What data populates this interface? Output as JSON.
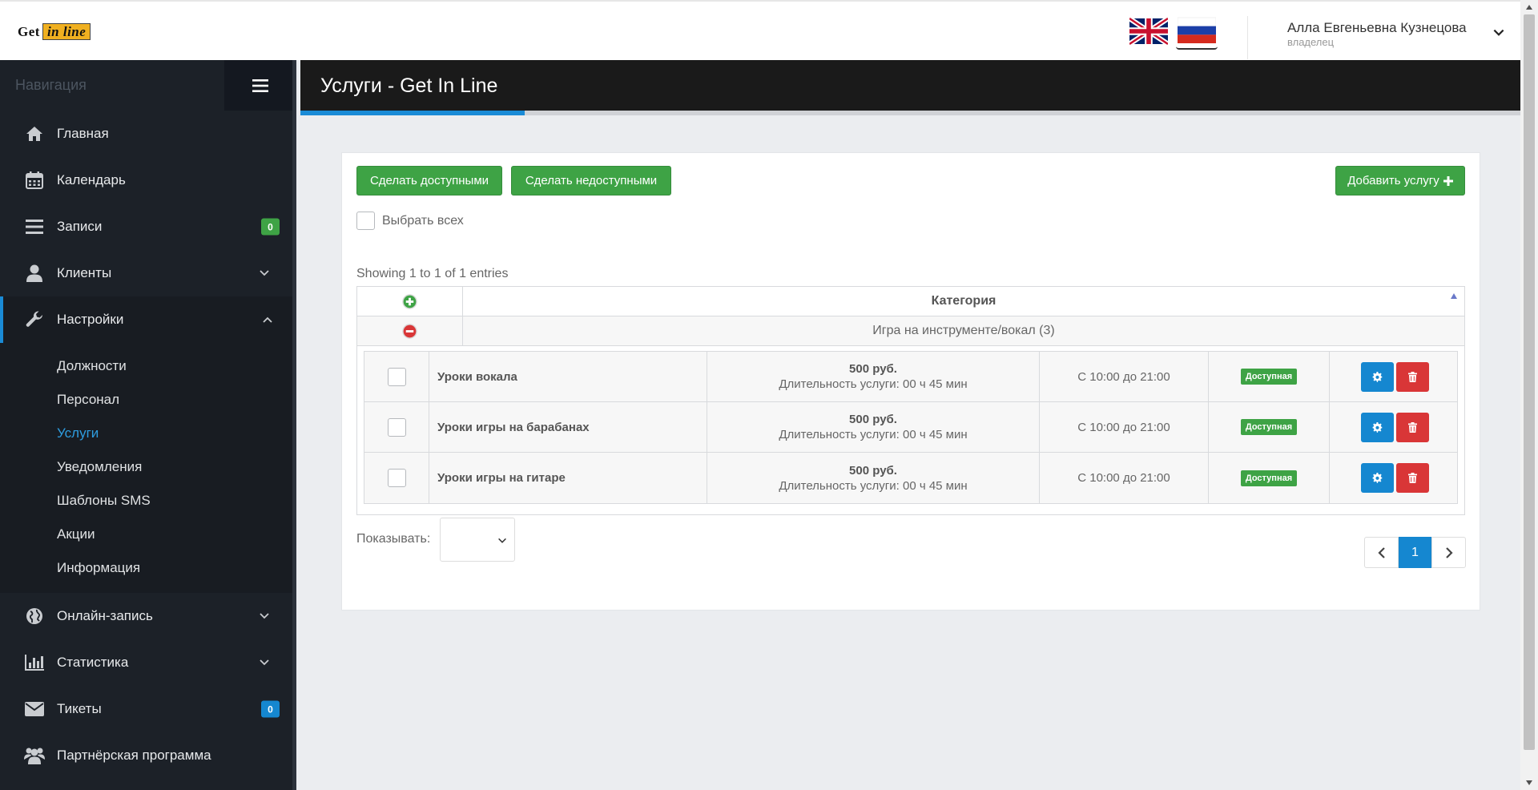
{
  "header": {
    "logo_text": "Get",
    "logo_highlight": "in line",
    "flags": [
      "english-flag-icon",
      "russian-flag-icon"
    ],
    "user_name": "Алла Евгеньевна Кузнецова",
    "user_role": "владелец"
  },
  "sidebar": {
    "title": "Навигация",
    "items": [
      {
        "label": "Главная",
        "icon": "home-icon"
      },
      {
        "label": "Календарь",
        "icon": "calendar-icon"
      },
      {
        "label": "Записи",
        "icon": "list-icon",
        "badge": "0"
      },
      {
        "label": "Клиенты",
        "icon": "user-icon",
        "expandable": true
      },
      {
        "label": "Настройки",
        "icon": "wrench-icon",
        "expanded": true
      },
      {
        "label": "Онлайн-запись",
        "icon": "globe-icon",
        "expandable": true
      },
      {
        "label": "Статистика",
        "icon": "bar-chart-icon",
        "expandable": true
      },
      {
        "label": "Тикеты",
        "icon": "envelope-icon",
        "badge": "0"
      },
      {
        "label": "Партнёрская программа",
        "icon": "users-icon"
      }
    ],
    "sub_items": [
      "Должности",
      "Персонал",
      "Услуги",
      "Уведомления",
      "Шаблоны SMS",
      "Акции",
      "Информация"
    ],
    "current_sub": "Услуги"
  },
  "page": {
    "title": "Услуги - Get In Line"
  },
  "toolbar": {
    "make_available": "Сделать доступными",
    "make_unavailable": "Сделать недоступными",
    "add_service": "Добавить услугу",
    "select_all": "Выбрать всех"
  },
  "table": {
    "info": "Showing 1 to 1 of 1 entries",
    "header": "Категория",
    "group": "Игра на инструменте/вокал (3)",
    "services": [
      {
        "name": "Уроки вокала",
        "price": "500 руб.",
        "duration": "Длительность услуги: 00 ч 45 мин",
        "time": "С 10:00 до 21:00",
        "status": "Доступная"
      },
      {
        "name": "Уроки игры на барабанах",
        "price": "500 руб.",
        "duration": "Длительность услуги: 00 ч 45 мин",
        "time": "С 10:00 до 21:00",
        "status": "Доступная"
      },
      {
        "name": "Уроки игры на гитаре",
        "price": "500 руб.",
        "duration": "Длительность услуги: 00 ч 45 мин",
        "time": "С 10:00 до 21:00",
        "status": "Доступная"
      }
    ]
  },
  "footer": {
    "show_label": "Показывать:",
    "page": "1"
  },
  "colors": {
    "accent_blue": "#1587d0",
    "green": "#3ea345",
    "red": "#d93637",
    "sidebar_bg": "#1c2128"
  }
}
